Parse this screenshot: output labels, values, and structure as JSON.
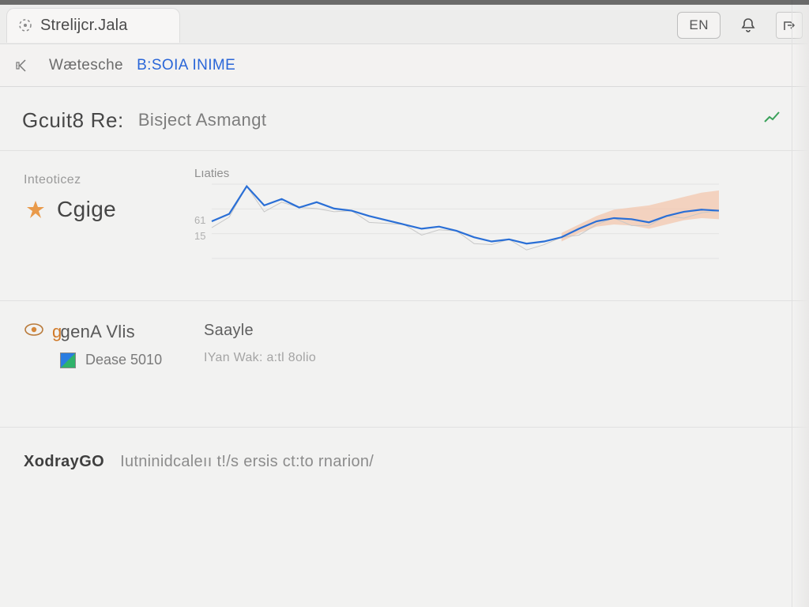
{
  "browser": {
    "tab_title": "Strelijcr.Jala",
    "pill_label": "EN",
    "address_prefix": "Wætesche",
    "address_highlight": "B:SOIA INIME"
  },
  "header": {
    "title": "Gcuit8 Re:",
    "subtitle": "Bisject Asmangt"
  },
  "panel1": {
    "left_caption": "Inteoticez",
    "metric_name": "Cgige",
    "chart_caption": "Lıaties",
    "yticks": [
      "61",
      "15"
    ]
  },
  "panel2": {
    "title_pre": "g",
    "title_mid": "gen",
    "title_suf": "A Vlis",
    "right_label": "Saayle",
    "legend_label": "Dease 5010",
    "right_sub": "IYan Wak: a:tl 8olio"
  },
  "footer": {
    "left": "XodrayGO",
    "right": "Iutninidcaleıı t!/s ersis ct:to rnarion/"
  },
  "chart_data": {
    "type": "line",
    "title": "Lıaties",
    "xlabel": "",
    "ylabel": "",
    "ylim": [
      10,
      80
    ],
    "x": [
      0,
      1,
      2,
      3,
      4,
      5,
      6,
      7,
      8,
      9,
      10,
      11,
      12,
      13,
      14,
      15,
      16,
      17,
      18,
      19,
      20,
      21,
      22,
      23,
      24,
      25,
      26,
      27,
      28,
      29
    ],
    "series": [
      {
        "name": "main",
        "color": "#2a6fd6",
        "values": [
          45,
          52,
          78,
          60,
          66,
          58,
          63,
          57,
          55,
          50,
          46,
          42,
          38,
          40,
          36,
          30,
          26,
          28,
          24,
          26,
          30,
          38,
          45,
          48,
          47,
          44,
          50,
          54,
          56,
          55
        ]
      },
      {
        "name": "band_upper",
        "color": "#f3c7ae",
        "values": [
          48,
          55,
          80,
          63,
          69,
          61,
          66,
          60,
          58,
          53,
          49,
          45,
          41,
          43,
          39,
          33,
          29,
          31,
          27,
          29,
          34,
          42,
          50,
          56,
          58,
          60,
          64,
          68,
          72,
          74
        ]
      },
      {
        "name": "band_lower",
        "color": "#f3c7ae",
        "values": [
          42,
          49,
          74,
          57,
          62,
          55,
          60,
          54,
          52,
          47,
          43,
          39,
          35,
          37,
          33,
          27,
          23,
          25,
          21,
          23,
          26,
          34,
          40,
          42,
          41,
          38,
          42,
          46,
          48,
          47
        ]
      }
    ]
  }
}
